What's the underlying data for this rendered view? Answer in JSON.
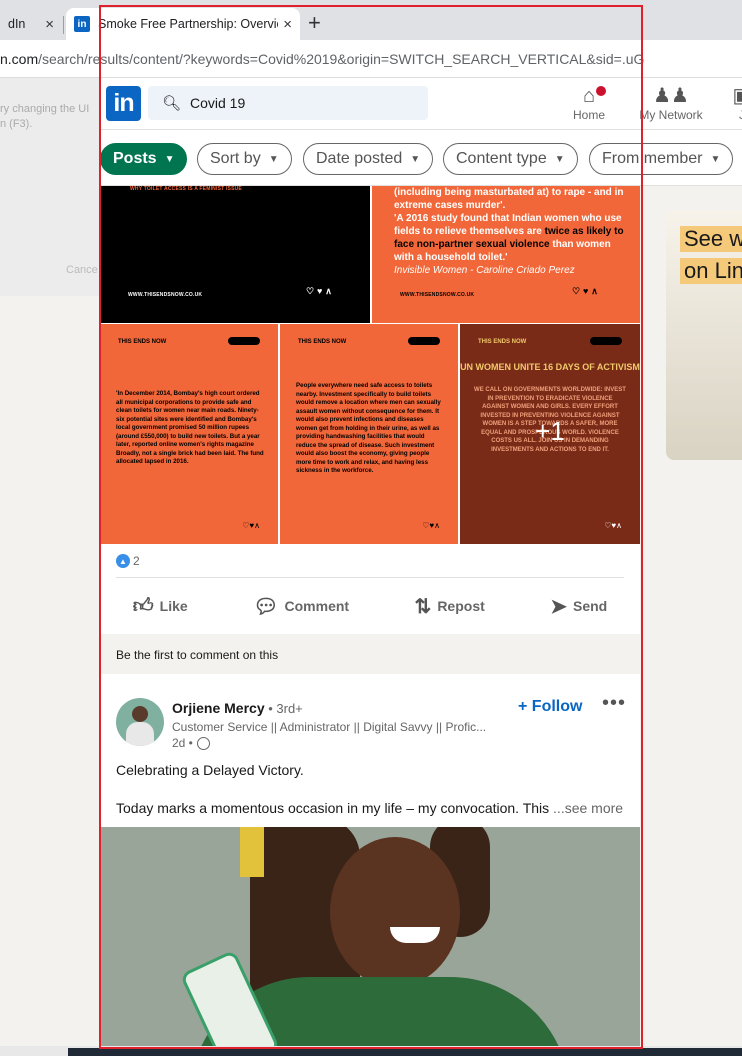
{
  "browser": {
    "tab1_title": "dIn",
    "tab2_title": "Smoke Free Partnership: Overvie",
    "tab_close": "×",
    "new_tab": "+",
    "url_host": "n.com",
    "url_path": "/search/results/content/?keywords=Covid%2019&origin=SWITCH_SEARCH_VERTICAL&sid=.uG"
  },
  "header": {
    "logo": "in",
    "search_value": "Covid 19",
    "nav": [
      {
        "label": "Home",
        "icon": "home-icon"
      },
      {
        "label": "My Network",
        "icon": "network-icon"
      },
      {
        "label": "J",
        "icon": "jobs-icon"
      }
    ]
  },
  "filters": [
    {
      "label": "Posts"
    },
    {
      "label": "Sort by"
    },
    {
      "label": "Date posted"
    },
    {
      "label": "Content type"
    },
    {
      "label": "From member"
    }
  ],
  "left_hint": {
    "line1": "ry changing the UI",
    "line2": "n (F3).",
    "cancel": "Cance"
  },
  "post1": {
    "tile1_caption": "WHY TOILET ACCESS IS A FEMINIST ISSUE",
    "tile1_url": "WWW.THISENDSNOW.CO.UK",
    "tile2_quote_part1": "(including being masturbated at) to rape - and in extreme cases murder'.",
    "tile2_quote_part2": "'A 2016 study found that Indian women who use fields to relieve themselves are",
    "tile2_bold1": "twice as likely to face non-partner sexual violence",
    "tile2_quote_part3": "than women with a household toilet.'",
    "tile2_source": "Invisible Women - Caroline Criado Perez",
    "tile2_url": "WWW.THISENDSNOW.CO.UK",
    "tile3_tag": "THIS ENDS NOW",
    "tile3_text": "'In December 2014, Bombay's high court ordered all municipal corporations to provide safe and clean toilets for women near main roads. Ninety-six potential sites were identified and Bombay's local government promised 50 million rupees (around £550,000) to build new toilets. But a year later, reported online women's rights magazine Broadly, not a single brick had been laid. The fund allocated lapsed in 2016.",
    "tile4_tag": "THIS ENDS NOW",
    "tile4_text": "People everywhere need safe access to toilets nearby. Investment specifically to build toilets would remove a location where men can sexually assault women without consequence for them. It would also prevent infections and diseases women get from holding in their urine, as well as providing handwashing facilities that would reduce the spread of disease. Such investment would also boost the economy, giving people more time to work and relax, and having less sickness in the workforce.",
    "tile5_tag": "THIS ENDS NOW",
    "tile5_title": "UN WOMEN UNITE 16 DAYS OF ACTIVISM",
    "tile5_text": "WE CALL ON GOVERNMENTS WORLDWIDE: INVEST IN PREVENTION TO ERADICATE VIOLENCE AGAINST WOMEN AND GIRLS. EVERY EFFORT INVESTED IN PREVENTING VIOLENCE AGAINST WOMEN IS A STEP TOWARDS A SAFER, MORE EQUAL AND PROSPEROUS WORLD. VIOLENCE COSTS US ALL. JOIN US IN DEMANDING INVESTMENTS AND ACTIONS TO END IT.",
    "more_images": "+1",
    "reaction_count": "2",
    "actions": [
      {
        "label": "Like",
        "icon": "thumbs-up-icon"
      },
      {
        "label": "Comment",
        "icon": "comment-icon"
      },
      {
        "label": "Repost",
        "icon": "repost-icon"
      },
      {
        "label": "Send",
        "icon": "send-icon"
      }
    ],
    "first_comment": "Be the first to comment on this"
  },
  "post2": {
    "author": "Orjiene Mercy",
    "degree": " • 3rd+",
    "headline": "Customer Service || Administrator || Digital Savvy || Profic...",
    "time": "2d •",
    "follow": "+ Follow",
    "more": "•••",
    "text1": "Celebrating a Delayed Victory.",
    "text2": "Today marks a momentous occasion in my life – my convocation. This",
    "see_more": " ...see more"
  },
  "right_ad": {
    "line1": "See w",
    "line2": "on Lin"
  },
  "colors": {
    "linkedin_blue": "#0a66c2",
    "posts_green": "#01754f",
    "tile_orange": "#f26739",
    "highlight_red": "#e0202a"
  }
}
